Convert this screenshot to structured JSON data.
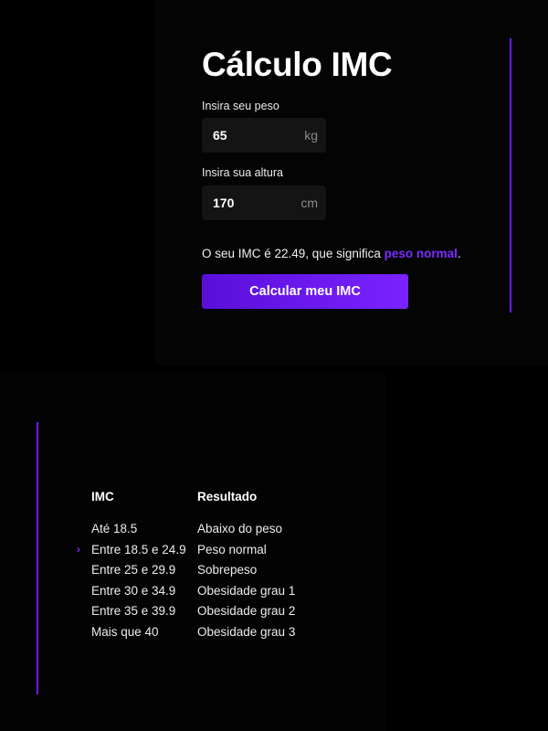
{
  "calculator": {
    "title": "Cálculo IMC",
    "weight": {
      "label": "Insira seu peso",
      "value": "65",
      "unit": "kg"
    },
    "height": {
      "label": "Insira sua altura",
      "value": "170",
      "unit": "cm"
    },
    "result": {
      "prefix": "O seu IMC é 22.49, que significa ",
      "classification": "peso normal",
      "suffix": "."
    },
    "button_label": "Calcular meu IMC"
  },
  "table": {
    "headers": {
      "imc": "IMC",
      "result": "Resultado"
    },
    "selected_marker": "›",
    "rows": [
      {
        "range": "Até 18.5",
        "result": "Abaixo do peso"
      },
      {
        "range": "Entre 18.5 e 24.9",
        "result": "Peso normal"
      },
      {
        "range": "Entre 25 e 29.9",
        "result": "Sobrepeso"
      },
      {
        "range": "Entre 30 e 34.9",
        "result": "Obesidade grau 1"
      },
      {
        "range": "Entre 35 e 39.9",
        "result": "Obesidade grau 2"
      },
      {
        "range": "Mais que 40",
        "result": "Obesidade grau 3"
      }
    ]
  },
  "colors": {
    "accent": "#6a1bff",
    "highlight": "#7c2bff",
    "background": "#000000"
  }
}
